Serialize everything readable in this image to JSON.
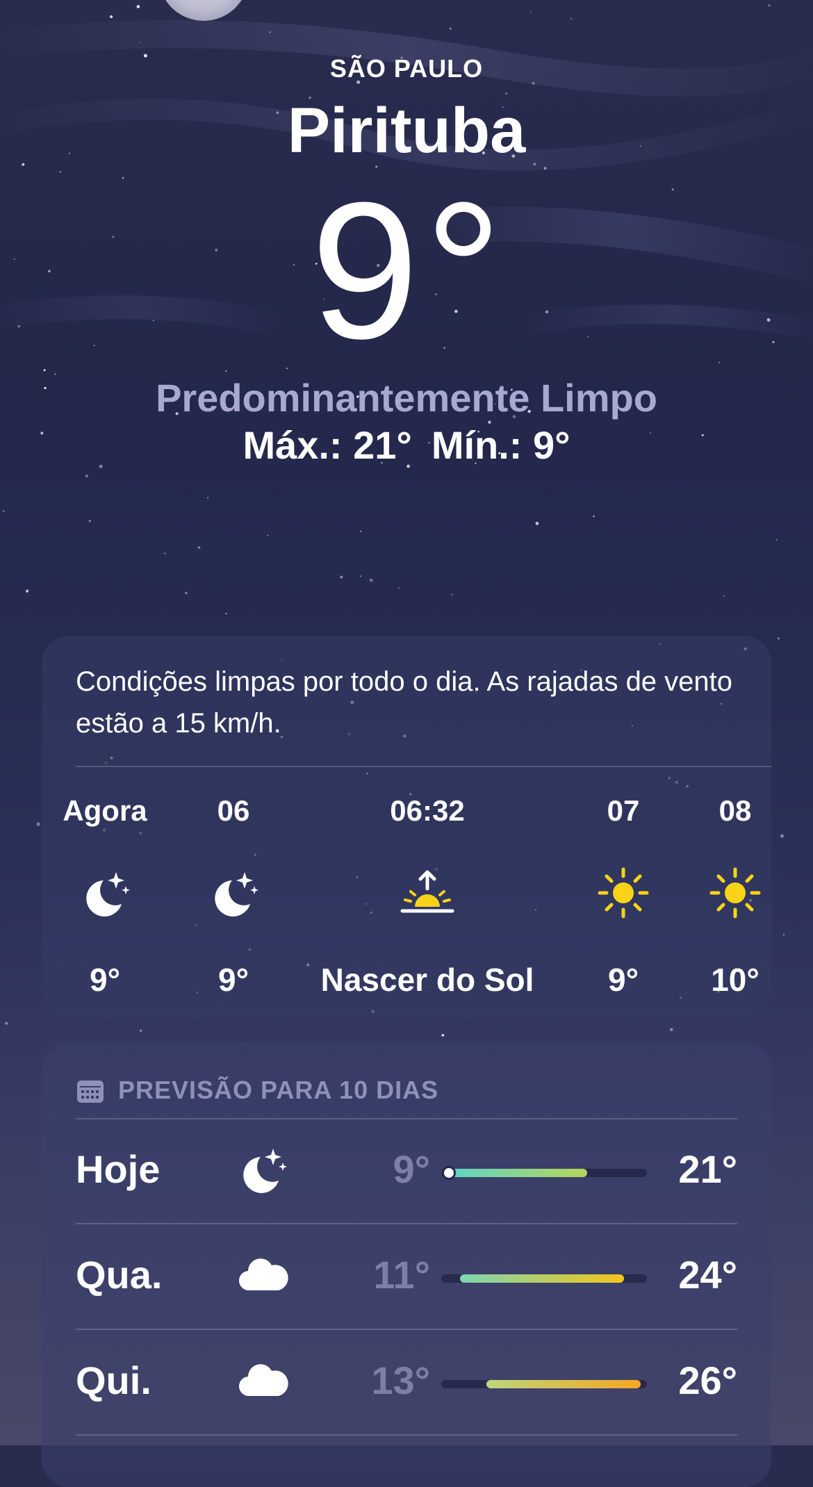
{
  "location": {
    "region": "SÃO PAULO",
    "city": "Pirituba"
  },
  "current": {
    "temperature": "9",
    "degree_symbol": "°",
    "condition": "Predominantemente Limpo",
    "high_label": "Máx.: 21°",
    "low_label": "Mín.: 9°"
  },
  "hourly": {
    "summary": "Condições limpas por todo o dia. As rajadas de vento estão a 15 km/h.",
    "items": [
      {
        "label": "Agora",
        "icon": "moon-stars-icon",
        "temp": "9°"
      },
      {
        "label": "06",
        "icon": "moon-stars-icon",
        "temp": "9°"
      },
      {
        "label": "06:32",
        "icon": "sunrise-icon",
        "temp": "Nascer do Sol"
      },
      {
        "label": "07",
        "icon": "sun-icon",
        "temp": "9°"
      },
      {
        "label": "08",
        "icon": "sun-icon",
        "temp": "10°"
      }
    ]
  },
  "forecast": {
    "title": "PREVISÃO PARA 10 DIAS",
    "icon": "calendar-icon",
    "days": [
      {
        "day": "Hoje",
        "icon": "moon-stars-icon",
        "low": "9°",
        "high": "21°",
        "range_start": 0.03,
        "range_end": 0.71,
        "current": 0.03,
        "colors": [
          "#5ed3c8",
          "#b6d65a"
        ]
      },
      {
        "day": "Qua.",
        "icon": "cloud-icon",
        "low": "11°",
        "high": "24°",
        "range_start": 0.09,
        "range_end": 0.89,
        "colors": [
          "#7dd6b4",
          "#f5c518"
        ]
      },
      {
        "day": "Qui.",
        "icon": "cloud-icon",
        "low": "13°",
        "high": "26°",
        "range_start": 0.22,
        "range_end": 0.97,
        "colors": [
          "#bcd77a",
          "#f5a623"
        ]
      }
    ]
  },
  "colors": {
    "sun": "#f9d317",
    "condition_text": "#a8a9d0",
    "muted_text": "#7c7fa8"
  }
}
